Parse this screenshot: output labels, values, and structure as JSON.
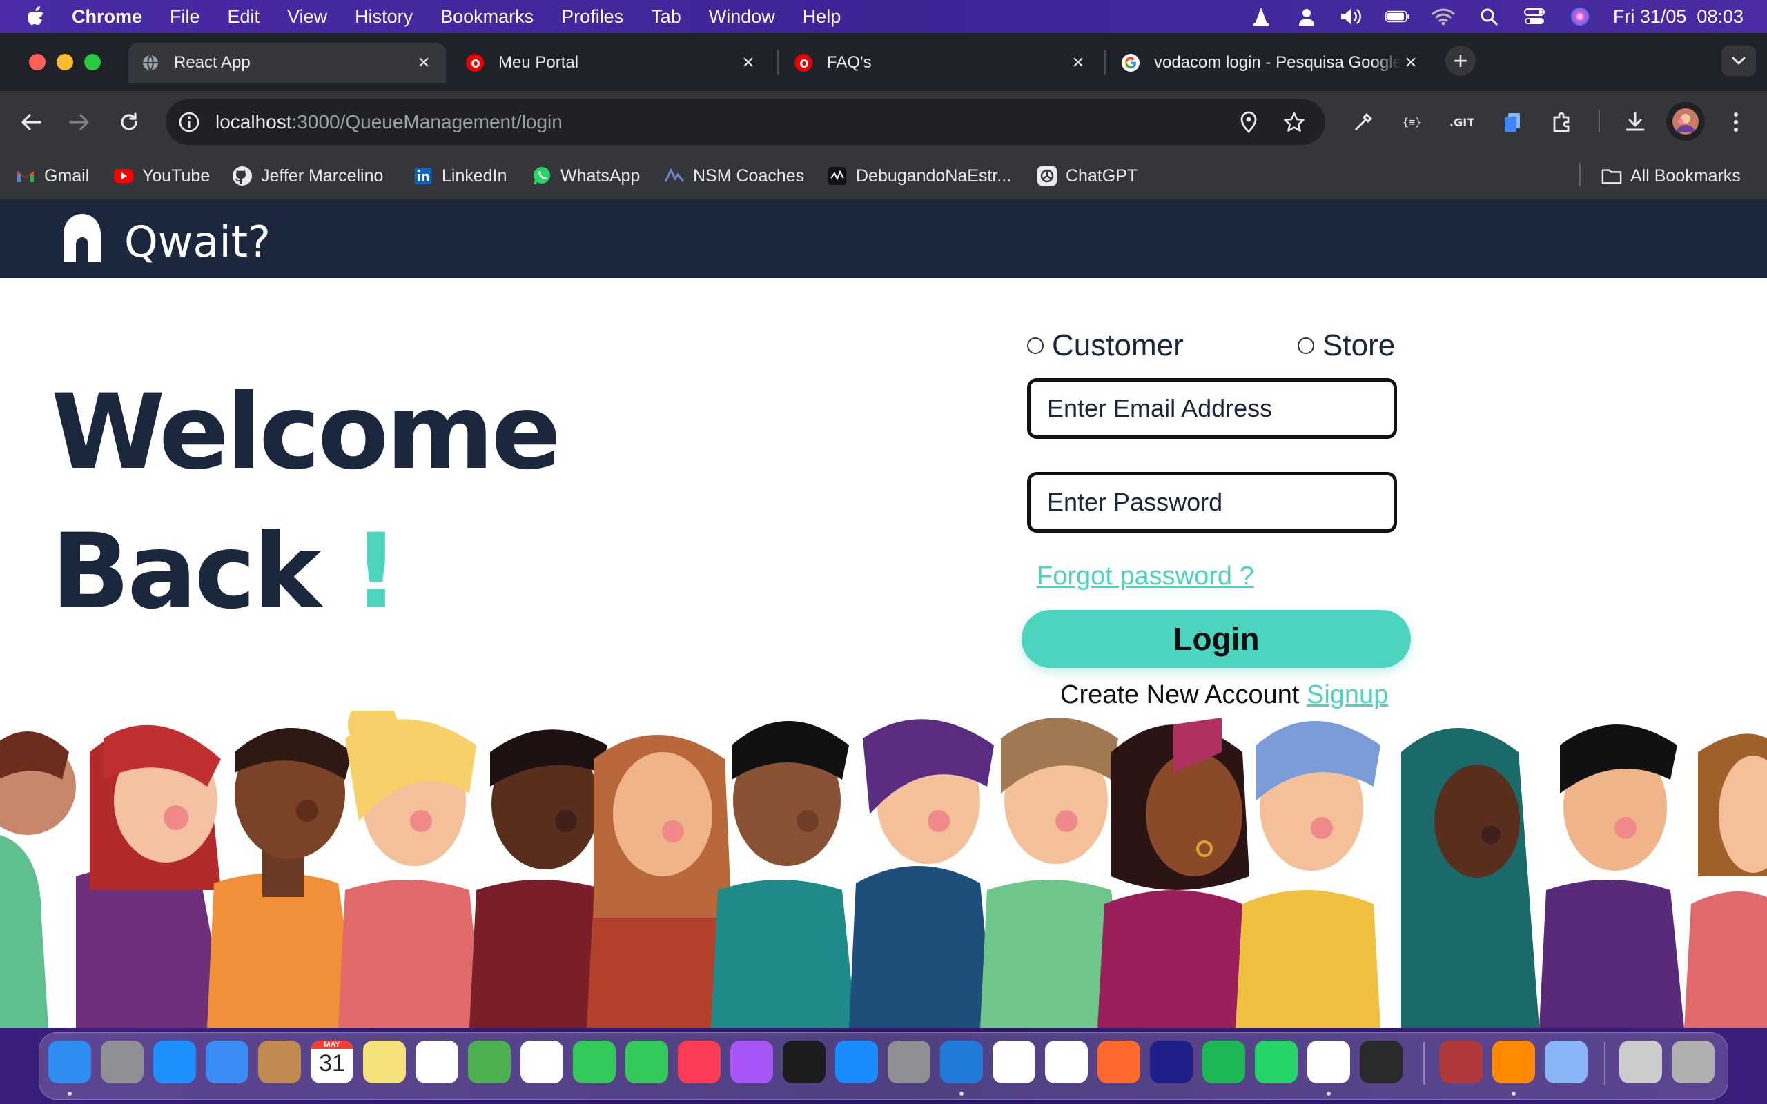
{
  "menubar": {
    "app": "Chrome",
    "items": [
      "File",
      "Edit",
      "View",
      "History",
      "Bookmarks",
      "Profiles",
      "Tab",
      "Window",
      "Help"
    ],
    "datetime": "Fri 31/05  08:03",
    "status_icons": [
      "vlc-icon",
      "user-icon",
      "volume-icon",
      "battery-icon",
      "wifi-icon",
      "spotlight-icon",
      "control-center-icon",
      "siri-icon"
    ]
  },
  "tabs": [
    {
      "title": "React App",
      "icon": "globe-icon",
      "active": true
    },
    {
      "title": "Meu Portal",
      "icon": "vodafone-icon",
      "active": false
    },
    {
      "title": "FAQ's",
      "icon": "vodafone-icon",
      "active": false
    },
    {
      "title": "vodacom login - Pesquisa Google",
      "icon": "google-icon",
      "active": false
    }
  ],
  "address": {
    "host": "localhost",
    "path": ":3000/QueueManagement/login"
  },
  "bookmarks": [
    {
      "label": "Gmail",
      "icon": "gmail-icon"
    },
    {
      "label": "YouTube",
      "icon": "youtube-icon"
    },
    {
      "label": "Jeffer Marcelino",
      "icon": "github-icon"
    },
    {
      "label": "LinkedIn",
      "icon": "linkedin-icon"
    },
    {
      "label": "WhatsApp",
      "icon": "whatsapp-icon"
    },
    {
      "label": "NSM Coaches",
      "icon": "nsm-icon"
    },
    {
      "label": "DebugandoNaEstr...",
      "icon": "debugando-icon"
    },
    {
      "label": "ChatGPT",
      "icon": "chatgpt-icon"
    }
  ],
  "all_bookmarks": "All Bookmarks",
  "app": {
    "brand": "Qwait?",
    "welcome_line1": "Welcome",
    "welcome_line2": "Back",
    "welcome_excl": "!",
    "radio_customer": "Customer",
    "radio_store": "Store",
    "email_placeholder": "Enter Email Address",
    "password_placeholder": "Enter Password",
    "forgot": "Forgot password ?",
    "login": "Login",
    "create_prefix": "Create New Account",
    "signup": "Signup"
  },
  "colors": {
    "accent": "#4dd4bf",
    "navy": "#1b273c"
  },
  "calendar_day": "31",
  "calendar_month": "MAY",
  "dock": [
    "finder",
    "launchpad",
    "safari",
    "mail",
    "contacts",
    "calendar",
    "notes",
    "reminders",
    "maps",
    "photos",
    "messages",
    "facetime",
    "music",
    "podcasts",
    "apple-tv",
    "app-store",
    "system-settings",
    "vscode",
    "notion",
    "calendar-31",
    "sketch",
    "intellij",
    "spotify",
    "whatsapp",
    "chrome",
    "quicktime",
    "dictionary",
    "vlc",
    "preview",
    "scanner",
    "trash"
  ]
}
